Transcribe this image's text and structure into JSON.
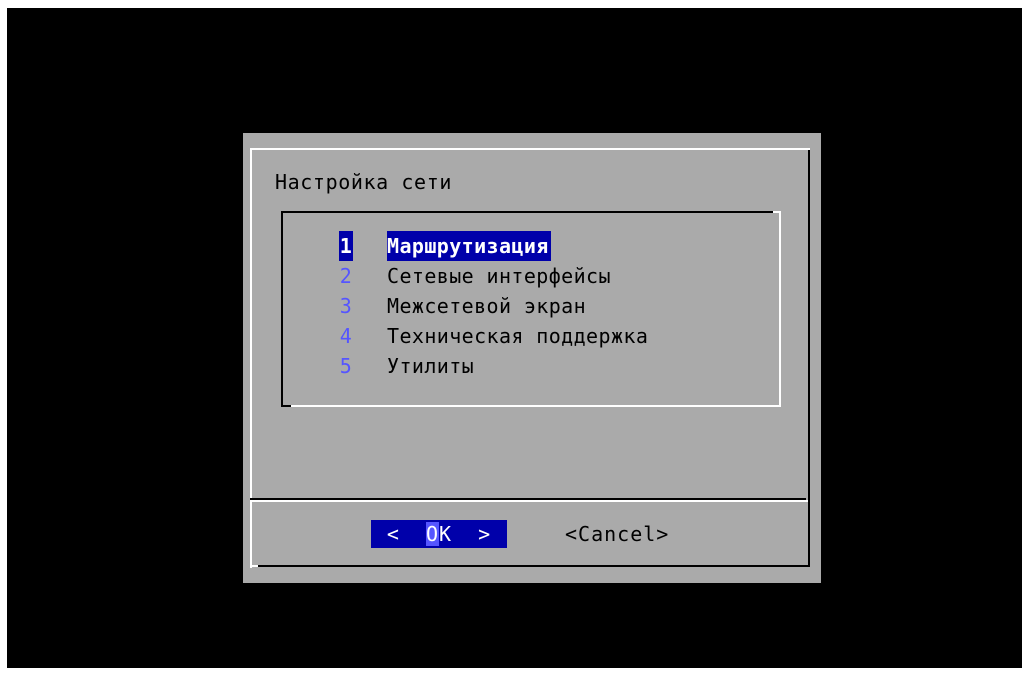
{
  "dialog": {
    "title": "Настройка сети"
  },
  "menu": {
    "items": [
      {
        "key": "1",
        "label": "Маршрутизация",
        "selected": true
      },
      {
        "key": "2",
        "label": "Сетевые интерфейсы",
        "selected": false
      },
      {
        "key": "3",
        "label": "Межсетевой экран",
        "selected": false
      },
      {
        "key": "4",
        "label": "Техническая поддержка",
        "selected": false
      },
      {
        "key": "5",
        "label": "Утилиты",
        "selected": false
      }
    ]
  },
  "buttons": {
    "ok_left": "<",
    "ok_hotkey": "O",
    "ok_rest": "K",
    "ok_right": ">",
    "cancel_label": "<Cancel>"
  },
  "colors": {
    "screen_background": "#000000",
    "dialog_background": "#aaaaaa",
    "selection_background": "#0000aa",
    "hotkey_number": "#5555ff"
  }
}
